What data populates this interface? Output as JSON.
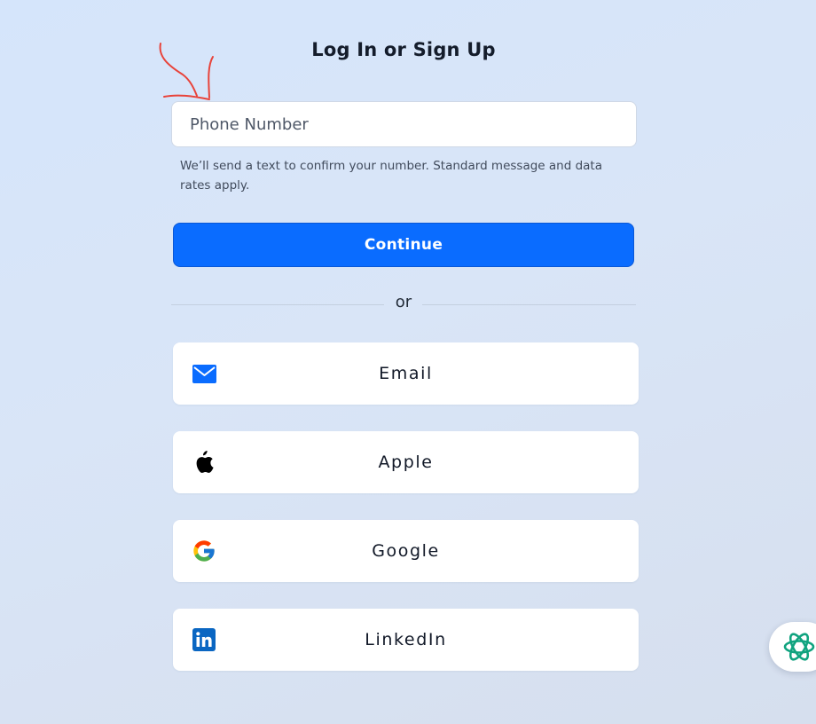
{
  "page": {
    "title": "Log In or Sign Up"
  },
  "phone": {
    "placeholder": "Phone Number",
    "disclaimer": "We’ll send a text to confirm your number. Standard message and data rates apply."
  },
  "continue_label": "Continue",
  "divider_label": "or",
  "social_buttons": [
    {
      "label": "Email",
      "icon": "mail-icon"
    },
    {
      "label": "Apple",
      "icon": "apple-icon"
    },
    {
      "label": "Google",
      "icon": "google-icon"
    },
    {
      "label": "LinkedIn",
      "icon": "linkedin-icon"
    }
  ],
  "colors": {
    "primary": "#0a6cff",
    "annotation": "#e8433a",
    "linkedin": "#0a66c2",
    "assistant": "#10a37f"
  }
}
